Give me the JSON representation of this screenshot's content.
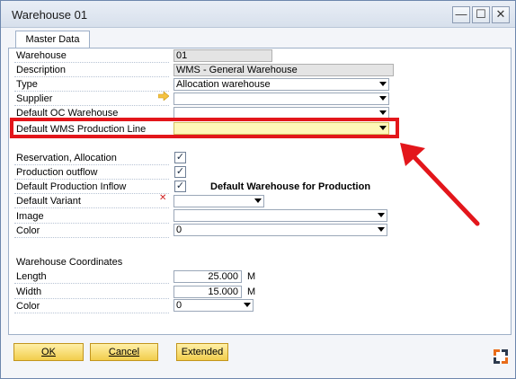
{
  "window": {
    "title": "Warehouse 01",
    "buttons": {
      "minimize": "—",
      "maximize": "☐",
      "close": "✕"
    }
  },
  "tabs": [
    {
      "label": "Master Data"
    }
  ],
  "fields": {
    "warehouse": {
      "label": "Warehouse",
      "value": "01"
    },
    "description": {
      "label": "Description",
      "value": "WMS - General Warehouse"
    },
    "type": {
      "label": "Type",
      "value": "Allocation warehouse"
    },
    "supplier": {
      "label": "Supplier",
      "value": ""
    },
    "default_oc_warehouse": {
      "label": "Default OC Warehouse",
      "value": ""
    },
    "default_wms_production_line": {
      "label": "Default WMS Production Line",
      "value": ""
    },
    "reservation_allocation": {
      "label": "Reservation, Allocation",
      "checked": true
    },
    "production_outflow": {
      "label": "Production outflow",
      "checked": true
    },
    "default_production_inflow": {
      "label": "Default Production Inflow",
      "checked": true
    },
    "default_warehouse_for_production": {
      "label": "Default Warehouse for Production"
    },
    "default_variant": {
      "label": "Default Variant",
      "value": ""
    },
    "image": {
      "label": "Image",
      "value": ""
    },
    "color": {
      "label": "Color",
      "value": "0"
    }
  },
  "coordinates": {
    "section_label": "Warehouse Coordinates",
    "length": {
      "label": "Length",
      "value": "25.000",
      "unit": "M"
    },
    "width": {
      "label": "Width",
      "value": "15.000",
      "unit": "M"
    },
    "color": {
      "label": "Color",
      "value": "0"
    }
  },
  "buttons": {
    "ok": {
      "label": "OK"
    },
    "cancel": {
      "label": "Cancel"
    },
    "extended": {
      "label": "Extended"
    }
  },
  "icons": [
    "link-arrow-icon",
    "required-x-icon",
    "dropdown-chevron-icon",
    "checkmark-icon",
    "form-settings-icon",
    "red-annotation-arrow"
  ],
  "colors": {
    "highlight": "#e3161b",
    "button_gradient_top": "#fff0a8",
    "button_gradient_bottom": "#f2cd4c",
    "yellow_field": "#fff7b8"
  }
}
